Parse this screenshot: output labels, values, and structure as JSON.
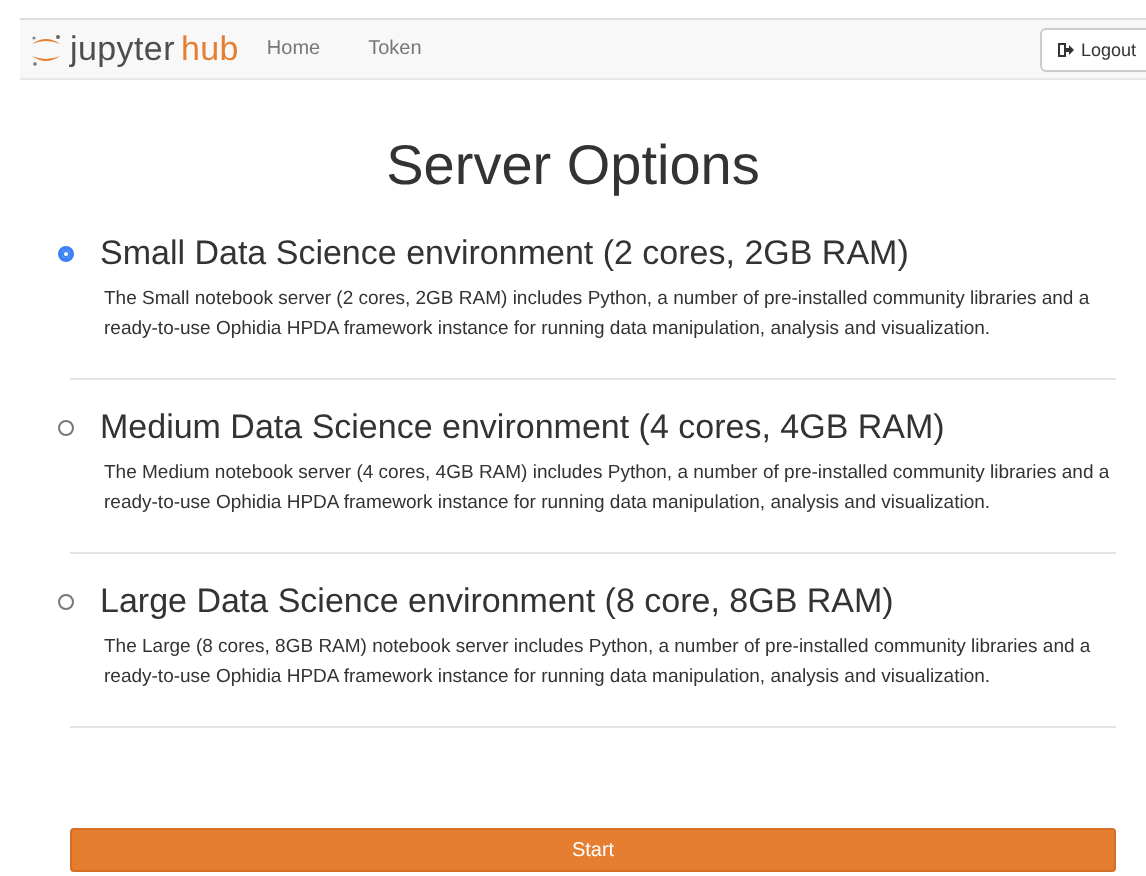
{
  "navbar": {
    "logo": {
      "first": "jupyter",
      "second": "hub"
    },
    "links": [
      "Home",
      "Token"
    ],
    "logout": "Logout"
  },
  "heading": "Server Options",
  "options": [
    {
      "title": "Small Data Science environment (2 cores, 2GB RAM)",
      "description": "The Small notebook server (2 cores, 2GB RAM) includes Python, a number of pre-installed community libraries and a ready-to-use Ophidia HPDA framework instance for running data manipulation, analysis and visualization.",
      "selected": true
    },
    {
      "title": "Medium Data Science environment (4 cores, 4GB RAM)",
      "description": "The Medium notebook server (4 cores, 4GB RAM) includes Python, a number of pre-installed community libraries and a ready-to-use Ophidia HPDA framework instance for running data manipulation, analysis and visualization.",
      "selected": false
    },
    {
      "title": "Large Data Science environment (8 core, 8GB RAM)",
      "description": "The Large (8 cores, 8GB RAM) notebook server includes Python, a number of pre-installed community libraries and a ready-to-use Ophidia HPDA framework instance for running data manipulation, analysis and visualization.",
      "selected": false
    }
  ],
  "start_button": "Start"
}
